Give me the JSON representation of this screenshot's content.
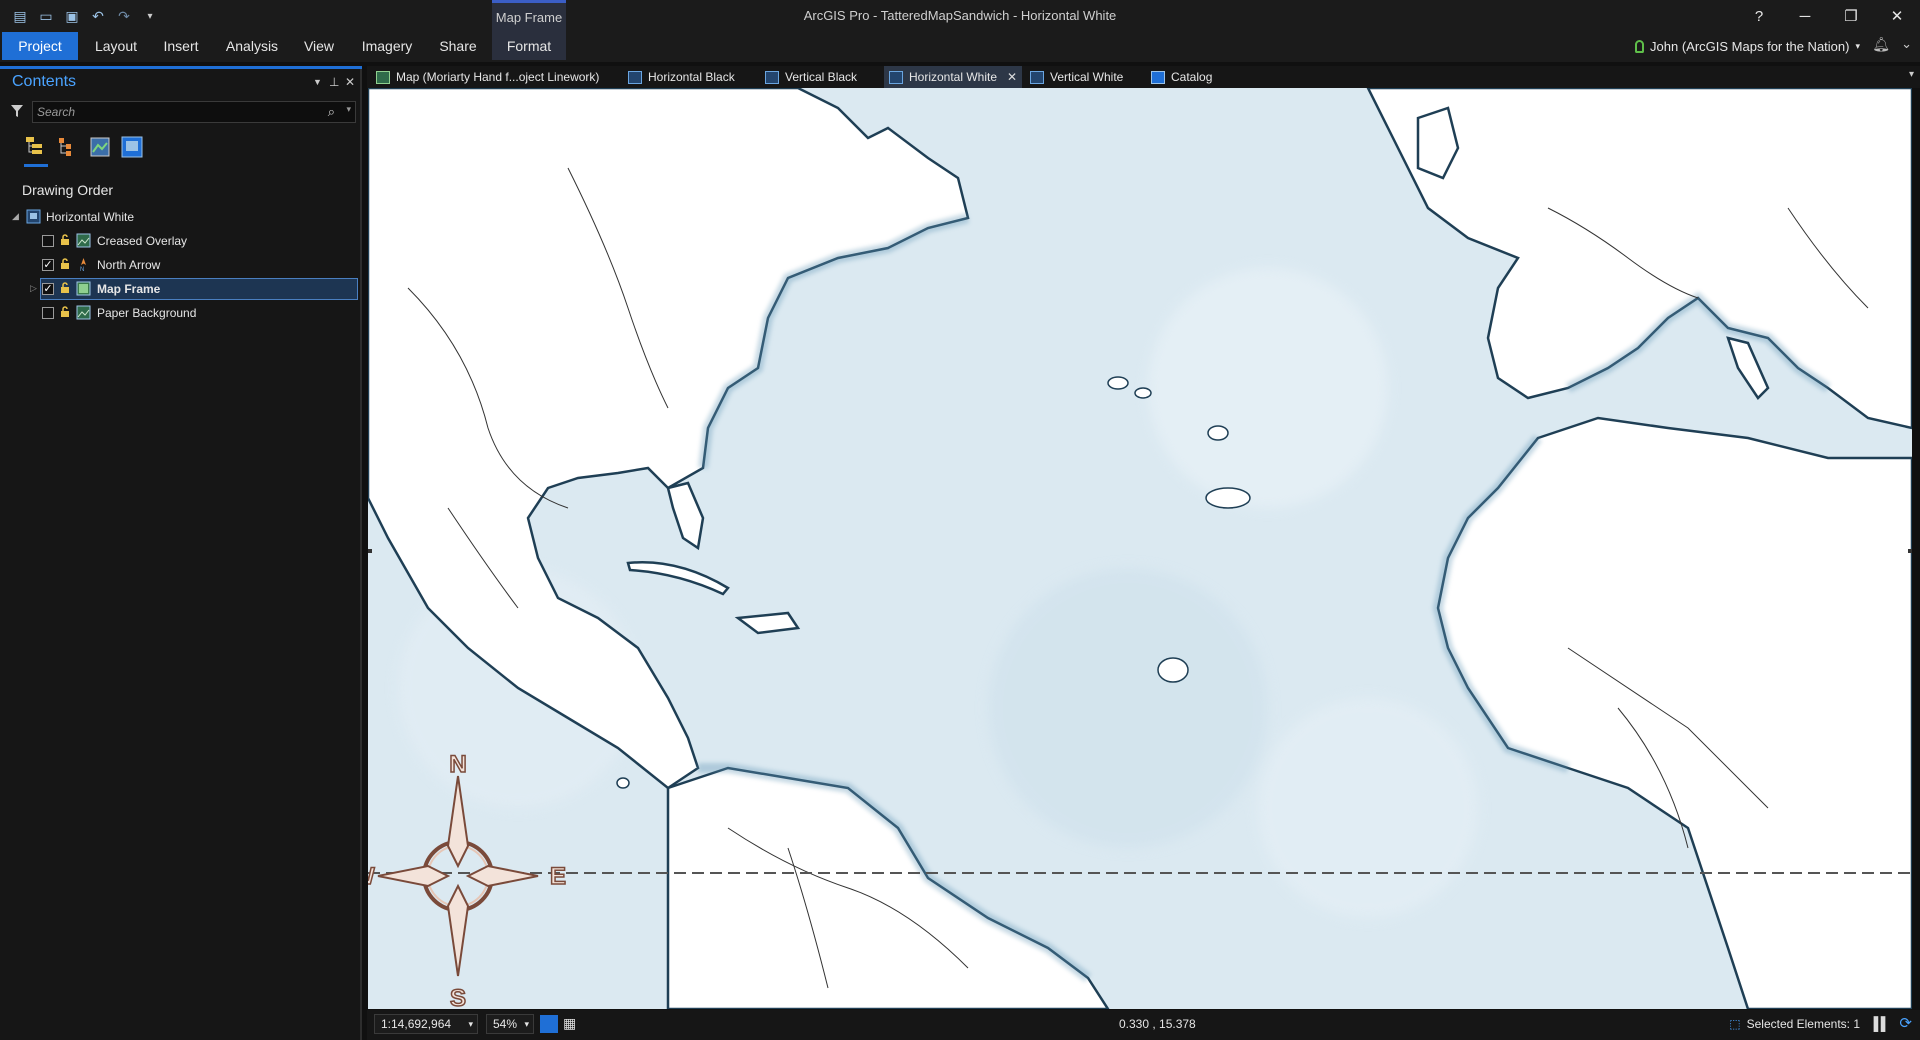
{
  "titlebar": {
    "app_title": "ArcGIS Pro - TatteredMapSandwich - Horizontal White",
    "context_group": "Map Frame",
    "help": "?",
    "minimize": "─",
    "restore": "❐",
    "close": "✕"
  },
  "ribbon": {
    "tabs": [
      "Project",
      "Layout",
      "Insert",
      "Analysis",
      "View",
      "Imagery",
      "Share",
      "Format"
    ],
    "active_tab": "Project",
    "user": "John (ArcGIS Maps for the Nation)"
  },
  "contents": {
    "title": "Contents",
    "search_placeholder": "Search",
    "section": "Drawing Order",
    "root": "Horizontal White",
    "items": [
      {
        "label": "Creased Overlay",
        "checked": false
      },
      {
        "label": "North Arrow",
        "checked": true
      },
      {
        "label": "Map Frame",
        "checked": true,
        "selected": true
      },
      {
        "label": "Paper Background",
        "checked": false
      }
    ]
  },
  "doc_tabs": [
    {
      "label": "Map (Moriarty Hand f...oject Linework)"
    },
    {
      "label": "Horizontal Black"
    },
    {
      "label": "Vertical Black"
    },
    {
      "label": "Horizontal White",
      "active": true
    },
    {
      "label": "Vertical White"
    },
    {
      "label": "Catalog"
    }
  ],
  "map": {
    "compass": {
      "n": "N",
      "s": "S",
      "e": "E",
      "w": "W"
    }
  },
  "status": {
    "scale": "1:14,692,964",
    "zoom": "54%",
    "coords": "0.330 , 15.378",
    "selected": "Selected Elements: 1"
  },
  "colors": {
    "accent": "#1f6fd6",
    "ocean": "#dbe9f1",
    "coast": "#2c5d7c"
  }
}
